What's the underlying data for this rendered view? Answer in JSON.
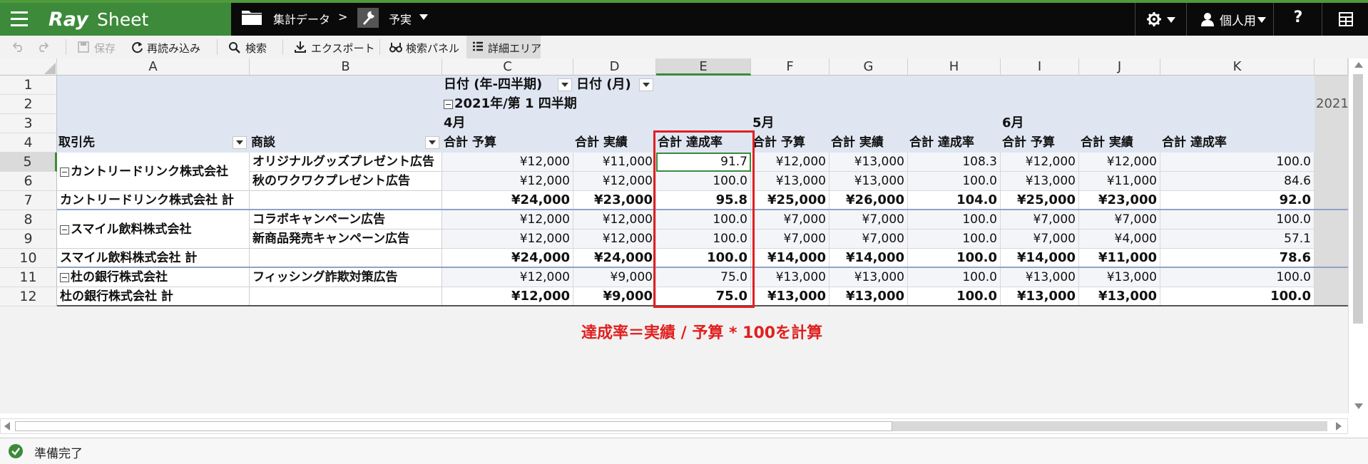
{
  "app": {
    "logo_primary": "Ray",
    "logo_secondary": "Sheet"
  },
  "breadcrumb": {
    "folder": "集計データ",
    "separator": ">",
    "current": "予実"
  },
  "header_right": {
    "settings_icon": "gear-icon",
    "user_label": "個人用",
    "help_label": "?",
    "panel_icon": "calculator-icon"
  },
  "toolbar": {
    "save_label": "保存",
    "reload_label": "再読み込み",
    "search_label": "検索",
    "export_label": "エクスポート",
    "search_panel_label": "検索パネル",
    "detail_area_label": "詳細エリア"
  },
  "grid": {
    "columns": [
      "A",
      "B",
      "C",
      "D",
      "E",
      "F",
      "G",
      "H",
      "I",
      "J",
      "K"
    ],
    "rows": [
      "1",
      "2",
      "3",
      "4",
      "5",
      "6",
      "7",
      "8",
      "9",
      "10",
      "11",
      "12"
    ],
    "pivot_headers": {
      "date_quarter": "日付 (年-四半期)",
      "date_month": "日付 (月)",
      "quarter_label": "2021年/第 1 四半期",
      "next_quarter_partial": "2021",
      "months": [
        "4月",
        "5月",
        "6月"
      ],
      "row_field_1": "取引先",
      "row_field_2": "商談",
      "measures": [
        "合計 予算",
        "合計 実績",
        "合計 達成率",
        "合計 予算",
        "合計 実績",
        "合計 達成率",
        "合計 予算",
        "合計 実績",
        "合計 達成率"
      ]
    },
    "body": [
      {
        "a": "カントリードリンク株式会社",
        "b": "オリジナルグッズプレゼント広告",
        "v": [
          "¥12,000",
          "¥11,000",
          "91.7",
          "¥12,000",
          "¥13,000",
          "108.3",
          "¥12,000",
          "¥12,000",
          "100.0"
        ]
      },
      {
        "a": "",
        "b": "秋のワクワクプレゼント広告",
        "v": [
          "¥12,000",
          "¥12,000",
          "100.0",
          "¥13,000",
          "¥13,000",
          "100.0",
          "¥13,000",
          "¥11,000",
          "84.6"
        ]
      },
      {
        "a": "カントリードリンク株式会社 計",
        "b": "",
        "v": [
          "¥24,000",
          "¥23,000",
          "95.8",
          "¥25,000",
          "¥26,000",
          "104.0",
          "¥25,000",
          "¥23,000",
          "92.0"
        ]
      },
      {
        "a": "スマイル飲料株式会社",
        "b": "コラボキャンペーン広告",
        "v": [
          "¥12,000",
          "¥12,000",
          "100.0",
          "¥7,000",
          "¥7,000",
          "100.0",
          "¥7,000",
          "¥7,000",
          "100.0"
        ]
      },
      {
        "a": "",
        "b": "新商品発売キャンペーン広告",
        "v": [
          "¥12,000",
          "¥12,000",
          "100.0",
          "¥7,000",
          "¥7,000",
          "100.0",
          "¥7,000",
          "¥4,000",
          "57.1"
        ]
      },
      {
        "a": "スマイル飲料株式会社 計",
        "b": "",
        "v": [
          "¥24,000",
          "¥24,000",
          "100.0",
          "¥14,000",
          "¥14,000",
          "100.0",
          "¥14,000",
          "¥11,000",
          "78.6"
        ]
      },
      {
        "a": "杜の銀行株式会社",
        "b": "フィッシング詐欺対策広告",
        "v": [
          "¥12,000",
          "¥9,000",
          "75.0",
          "¥13,000",
          "¥13,000",
          "100.0",
          "¥13,000",
          "¥13,000",
          "100.0"
        ]
      },
      {
        "a": "杜の銀行株式会社 計",
        "b": "",
        "v": [
          "¥12,000",
          "¥9,000",
          "75.0",
          "¥13,000",
          "¥13,000",
          "100.0",
          "¥13,000",
          "¥13,000",
          "100.0"
        ]
      }
    ]
  },
  "annotation": {
    "text": "達成率＝実績 / 予算 * 100を計算",
    "color": "#e02020"
  },
  "status": {
    "text": "準備完了"
  },
  "colors": {
    "accent_green": "#3c8a3a",
    "pivot_bg": "#dfe6f2",
    "highlight_red": "#e02020"
  }
}
